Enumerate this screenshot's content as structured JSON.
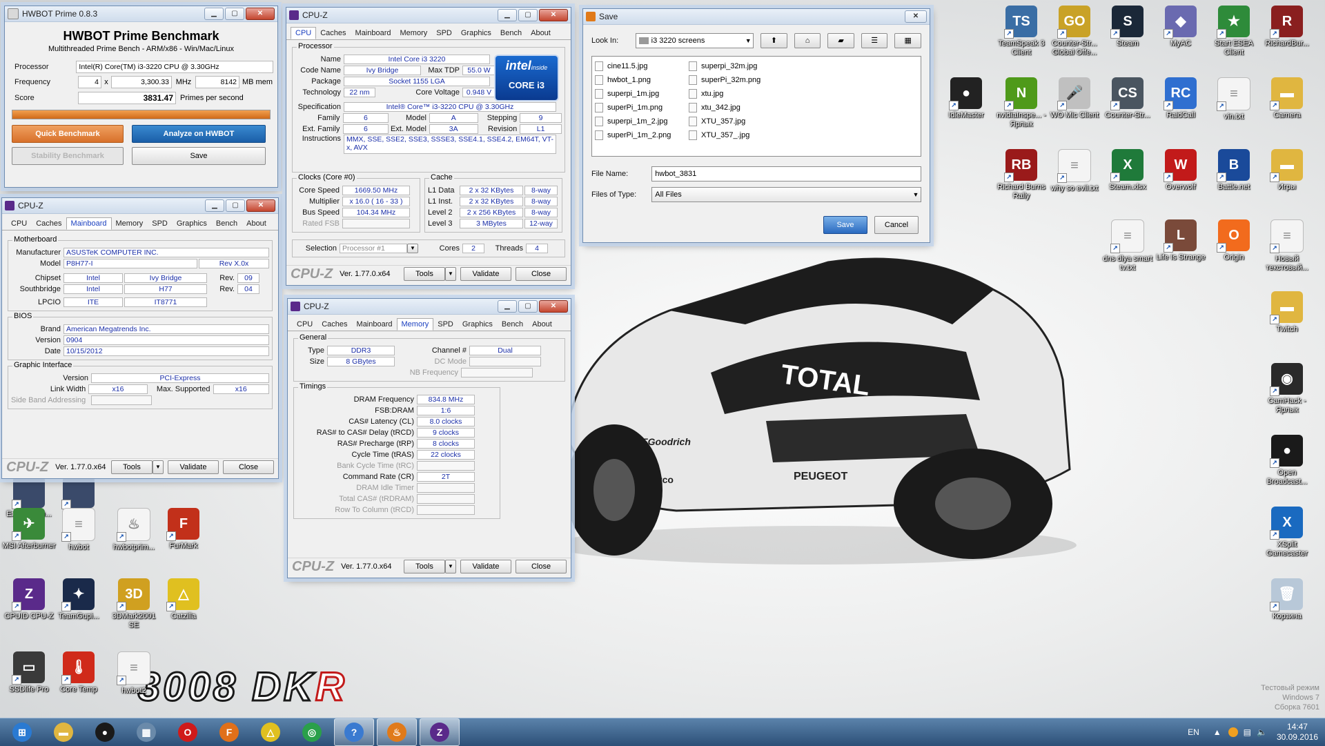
{
  "hwbot": {
    "title": "HWBOT Prime 0.8.3",
    "heading": "HWBOT Prime Benchmark",
    "subheading": "Multithreaded Prime Bench - ARM/x86 - Win/Mac/Linux",
    "processor_label": "Processor",
    "processor_value": "Intel(R) Core(TM) i3-3220 CPU @ 3.30GHz",
    "frequency_label": "Frequency",
    "frequency_cores": "4",
    "frequency_x": "x",
    "frequency_mhz": "3,300.33",
    "mhz_unit": "MHz",
    "mem_value": "8142",
    "mem_unit": "MB mem",
    "score_label": "Score",
    "score_value": "3831.47",
    "score_unit": "Primes per second",
    "progress_percent": 100,
    "quick_benchmark": "Quick Benchmark",
    "analyze": "Analyze on HWBOT",
    "stability": "Stability Benchmark",
    "save": "Save"
  },
  "cpuz_common": {
    "title": "CPU-Z",
    "logo": "CPU-Z",
    "version": "Ver. 1.77.0.x64",
    "tools": "Tools",
    "validate": "Validate",
    "close": "Close",
    "tabs": [
      "CPU",
      "Caches",
      "Mainboard",
      "Memory",
      "SPD",
      "Graphics",
      "Bench",
      "About"
    ]
  },
  "cpu_tab": {
    "processor_group": "Processor",
    "name_label": "Name",
    "name": "Intel Core i3 3220",
    "codename_label": "Code Name",
    "codename": "Ivy Bridge",
    "maxtdp_label": "Max TDP",
    "maxtdp": "55.0 W",
    "package_label": "Package",
    "package": "Socket 1155 LGA",
    "technology_label": "Technology",
    "technology": "22 nm",
    "corevoltage_label": "Core Voltage",
    "corevoltage": "0.948 V",
    "spec_label": "Specification",
    "spec": "Intel® Core™ i3-3220 CPU @ 3.30GHz",
    "family_label": "Family",
    "family": "6",
    "model_label": "Model",
    "model": "A",
    "stepping_label": "Stepping",
    "stepping": "9",
    "extfamily_label": "Ext. Family",
    "extfamily": "6",
    "extmodel_label": "Ext. Model",
    "extmodel": "3A",
    "revision_label": "Revision",
    "revision": "L1",
    "instructions_label": "Instructions",
    "instructions": "MMX, SSE, SSE2, SSE3, SSSE3, SSE4.1, SSE4.2, EM64T, VT-x, AVX",
    "intel_badge_brand": "intel",
    "intel_badge_inside": "inside",
    "intel_badge_core": "CORE i3",
    "clocks_group": "Clocks (Core #0)",
    "corespeed_label": "Core Speed",
    "corespeed": "1669.50 MHz",
    "multiplier_label": "Multiplier",
    "multiplier": "x 16.0 ( 16 - 33 )",
    "busspeed_label": "Bus Speed",
    "busspeed": "104.34 MHz",
    "ratedfsb_label": "Rated FSB",
    "cache_group": "Cache",
    "l1data_label": "L1 Data",
    "l1data": "2 x 32 KBytes",
    "l1data_way": "8-way",
    "l1inst_label": "L1 Inst.",
    "l1inst": "2 x 32 KBytes",
    "l1inst_way": "8-way",
    "l2_label": "Level 2",
    "l2": "2 x 256 KBytes",
    "l2_way": "8-way",
    "l3_label": "Level 3",
    "l3": "3 MBytes",
    "l3_way": "12-way",
    "selection_label": "Selection",
    "selection": "Processor #1",
    "cores_label": "Cores",
    "cores": "2",
    "threads_label": "Threads",
    "threads": "4"
  },
  "mainboard_tab": {
    "mb_group": "Motherboard",
    "manufacturer_label": "Manufacturer",
    "manufacturer": "ASUSTeK COMPUTER INC.",
    "model_label": "Model",
    "model": "P8H77-I",
    "model_rev": "Rev X.0x",
    "chipset_label": "Chipset",
    "chipset_vendor": "Intel",
    "chipset_name": "Ivy Bridge",
    "rev_label": "Rev.",
    "chipset_rev": "09",
    "southbridge_label": "Southbridge",
    "sb_vendor": "Intel",
    "sb_name": "H77",
    "sb_rev": "04",
    "lpcio_label": "LPCIO",
    "lpcio_vendor": "ITE",
    "lpcio_name": "IT8771",
    "bios_group": "BIOS",
    "brand_label": "Brand",
    "brand": "American Megatrends Inc.",
    "version_label": "Version",
    "version": "0904",
    "date_label": "Date",
    "date": "10/15/2012",
    "gi_group": "Graphic Interface",
    "gi_version_label": "Version",
    "gi_version": "PCI-Express",
    "linkwidth_label": "Link Width",
    "linkwidth": "x16",
    "maxsupported_label": "Max. Supported",
    "maxsupported": "x16",
    "sideband_label": "Side Band Addressing"
  },
  "memory_tab": {
    "general_group": "General",
    "type_label": "Type",
    "type": "DDR3",
    "channel_label": "Channel #",
    "channel": "Dual",
    "size_label": "Size",
    "size": "8 GBytes",
    "dcmode_label": "DC Mode",
    "nbfreq_label": "NB Frequency",
    "timings_group": "Timings",
    "dramfreq_label": "DRAM Frequency",
    "dramfreq": "834.8 MHz",
    "fsbdram_label": "FSB:DRAM",
    "fsbdram": "1:6",
    "cl_label": "CAS# Latency (CL)",
    "cl": "8.0 clocks",
    "trcd_label": "RAS# to CAS# Delay (tRCD)",
    "trcd": "9 clocks",
    "trp_label": "RAS# Precharge (tRP)",
    "trp": "8 clocks",
    "tras_label": "Cycle Time (tRAS)",
    "tras": "22 clocks",
    "trc_label": "Bank Cycle Time (tRC)",
    "cr_label": "Command Rate (CR)",
    "cr": "2T",
    "idle_label": "DRAM Idle Timer",
    "trdram_label": "Total CAS# (tRDRAM)",
    "rcd_label": "Row To Column (tRCD)"
  },
  "save_dialog": {
    "title": "Save",
    "lookin_label": "Look In:",
    "lookin_value": "i3 3220 screens",
    "files_col1": [
      "cine11.5.jpg",
      "hwbot_1.png",
      "superpi_1m.jpg",
      "superPi_1m.png",
      "superpi_1m_2.jpg",
      "superPi_1m_2.png"
    ],
    "files_col2": [
      "superpi_32m.jpg",
      "superPi_32m.png",
      "xtu.jpg",
      "xtu_342.jpg",
      "XTU_357.jpg",
      "XTU_357_.jpg"
    ],
    "filename_label": "File Name:",
    "filename_value": "hwbot_3831",
    "filetype_label": "Files of Type:",
    "filetype_value": "All Files",
    "save_button": "Save",
    "cancel_button": "Cancel"
  },
  "desktop_right": [
    {
      "label": "TeamSpeak 3 Client",
      "color": "#3a6ea5",
      "glyph": "TS"
    },
    {
      "label": "Counter-Str... Global Offe...",
      "color": "#c9a227",
      "glyph": "GO"
    },
    {
      "label": "Steam",
      "color": "#1b2838",
      "glyph": "S"
    },
    {
      "label": "MyAC",
      "color": "#6a6ab0",
      "glyph": "◆"
    },
    {
      "label": "Start ESEA Client",
      "color": "#2e8b3a",
      "glyph": "★"
    },
    {
      "label": "RichardBur...",
      "color": "#8a1f1f",
      "glyph": "R"
    },
    {
      "label": "IdleMaster",
      "color": "#222222",
      "glyph": "●"
    },
    {
      "label": "nvidiaInspe... - Ярлык",
      "color": "#4f9a1a",
      "glyph": "N"
    },
    {
      "label": "WO Mic Client",
      "color": "#c0c0c0",
      "glyph": "🎤"
    },
    {
      "label": "Counter-Str...",
      "color": "#4a5560",
      "glyph": "CS"
    },
    {
      "label": "RaidCall",
      "color": "#2f6fd0",
      "glyph": "RC"
    },
    {
      "label": "vin.txt",
      "color": "#f4f4f4",
      "glyph": "≡"
    },
    {
      "label": "Camera",
      "color": "#e0b640",
      "glyph": "▬"
    },
    {
      "label": "Richard Burns Rally",
      "color": "#9a1a1a",
      "glyph": "RB"
    },
    {
      "label": "why so evil.txt",
      "color": "#f4f4f4",
      "glyph": "≡"
    },
    {
      "label": "Steam.xlsx",
      "color": "#1f7a3a",
      "glyph": "X"
    },
    {
      "label": "Overwolf",
      "color": "#c21a1a",
      "glyph": "W"
    },
    {
      "label": "Battle.net",
      "color": "#1a4a9a",
      "glyph": "B"
    },
    {
      "label": "Игры",
      "color": "#e0b640",
      "glyph": "▬"
    },
    {
      "label": "dns dlya smart tv.txt",
      "color": "#f4f4f4",
      "glyph": "≡"
    },
    {
      "label": "Life Is Strange",
      "color": "#7a4a3a",
      "glyph": "L"
    },
    {
      "label": "Origin",
      "color": "#f26b1d",
      "glyph": "O"
    },
    {
      "label": "Новый текстовый...",
      "color": "#f4f4f4",
      "glyph": "≡"
    },
    {
      "label": "Twitch",
      "color": "#e0b640",
      "glyph": "▬"
    },
    {
      "label": "CamHack - Ярлык",
      "color": "#2a2a2a",
      "glyph": "◉"
    },
    {
      "label": "Open Broadcast...",
      "color": "#1a1a1a",
      "glyph": "●"
    },
    {
      "label": "XSplit Gamecaster",
      "color": "#1a6ac0",
      "glyph": "X"
    },
    {
      "label": "Корзина",
      "color": "#b8c8d8",
      "glyph": "🗑"
    }
  ],
  "desktop_left": [
    {
      "label": "Extreme Tu...",
      "color": "#3a4a6a",
      "glyph": ""
    },
    {
      "label": "GPU-Z",
      "color": "#3a4a6a",
      "glyph": ""
    },
    {
      "label": "MSI Afterburner",
      "color": "#3a8a3a",
      "glyph": "✈"
    },
    {
      "label": "hwbot",
      "color": "#f4f4f4",
      "glyph": "≡"
    },
    {
      "label": "hwbotprim...",
      "color": "#f4f4f4",
      "glyph": "♨"
    },
    {
      "label": "FurMark",
      "color": "#c2301a",
      "glyph": "F"
    },
    {
      "label": "CPUID CPU-Z",
      "color": "#5a2a8a",
      "glyph": "Z"
    },
    {
      "label": "TeamGupi...",
      "color": "#1a2a4a",
      "glyph": "✦"
    },
    {
      "label": "3DMark2001 SE",
      "color": "#d0a020",
      "glyph": "3D"
    },
    {
      "label": "Catzilla",
      "color": "#e0c020",
      "glyph": "△"
    },
    {
      "label": "SSDlife Pro",
      "color": "#3a3a3a",
      "glyph": "▭"
    },
    {
      "label": "Core Temp",
      "color": "#d02a1a",
      "glyph": "🌡"
    },
    {
      "label": "hwbot2",
      "color": "#f4f4f4",
      "glyph": "≡"
    }
  ],
  "wallpaper": {
    "logo_a": "3008",
    "logo_b": "DK",
    "logo_c": "R",
    "car_brand_front": "PEUGEOT",
    "car_sponsor": "TOTAL",
    "car_tyre": "BFGoodrich",
    "car_sparco": "sparco"
  },
  "watermark": {
    "line1": "Тестовый режим",
    "line2": "Windows 7",
    "line3": "Сборка 7601"
  },
  "taskbar": {
    "items": [
      {
        "name": "start",
        "color": "#2a7ad2",
        "glyph": "⊞",
        "active": false
      },
      {
        "name": "explorer",
        "color": "#e0b640",
        "glyph": "▬",
        "active": false
      },
      {
        "name": "obs",
        "color": "#1a1a1a",
        "glyph": "●",
        "active": false
      },
      {
        "name": "calculator",
        "color": "#6a8aaa",
        "glyph": "▦",
        "active": false
      },
      {
        "name": "opera",
        "color": "#d01a1a",
        "glyph": "O",
        "active": false
      },
      {
        "name": "firefox",
        "color": "#e0701a",
        "glyph": "F",
        "active": false
      },
      {
        "name": "catzilla",
        "color": "#e0c020",
        "glyph": "△",
        "active": false
      },
      {
        "name": "chrome",
        "color": "#2aa04a",
        "glyph": "◎",
        "active": false
      },
      {
        "name": "help",
        "color": "#3a7ad0",
        "glyph": "?",
        "active": true
      },
      {
        "name": "java",
        "color": "#e07a1a",
        "glyph": "♨",
        "active": true
      },
      {
        "name": "cpuz",
        "color": "#5a2a8a",
        "glyph": "Z",
        "active": true
      }
    ],
    "lang": "EN",
    "time": "14:47",
    "date": "30.09.2016"
  }
}
